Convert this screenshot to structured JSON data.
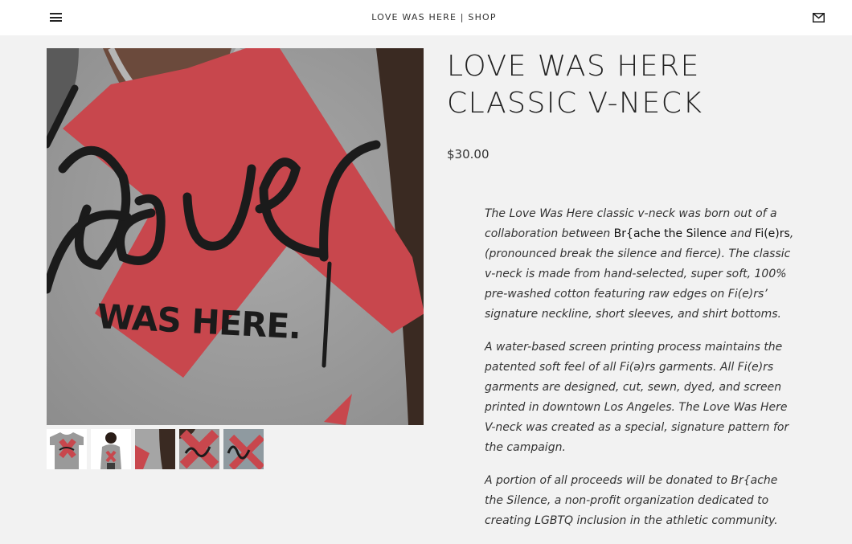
{
  "header": {
    "brand": "LOVE WAS HERE | SHOP",
    "menu_icon": "hamburger-menu-icon",
    "mail_icon": "mail-icon"
  },
  "product": {
    "title": "LOVE WAS HERE CLASSIC V-NECK",
    "price": "$30.00",
    "thumbnail_count": 5
  },
  "description": {
    "p1_a": " The Love Was Here classic v-neck was born out of a collaboration between ",
    "p1_link1": "Br{ache the Silence",
    "p1_b": " and ",
    "p1_link2": "Fi(e)rs",
    "p1_c": ", (pronounced break the silence and fierce). The classic v-neck is made from hand-selected, super soft, 100% pre-washed cotton featuring raw edges on Fi(e)rs’ signature neckline, short sleeves, and shirt bottoms.",
    "p2": " A water-based screen printing process maintains the patented soft feel of all Fi(ə)rs garments. All Fi(e)rs garments are designed, cut, sewn, dyed, and screen printed in downtown Los Angeles. The Love Was Here V-neck was created as a special, signature pattern for the campaign.",
    "p3": " A portion of all proceeds will be donated to Br{ache the Silence, a non-profit organization dedicated to creating LGBTQ inclusion in the athletic community."
  },
  "colors": {
    "background": "#f2f2f2",
    "shirt_gray": "#9d9d9d",
    "print_red": "#c8474d",
    "ink_black": "#1b1b1b"
  }
}
